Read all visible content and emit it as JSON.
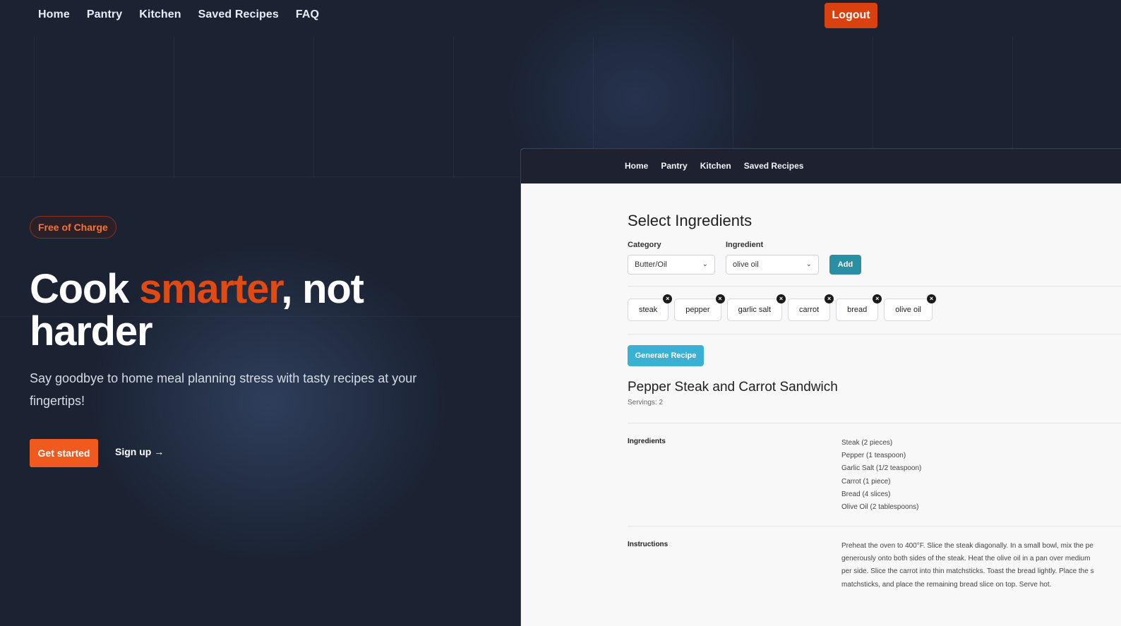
{
  "nav": {
    "links": [
      "Home",
      "Pantry",
      "Kitchen",
      "Saved Recipes",
      "FAQ"
    ],
    "logout_label": "Logout"
  },
  "hero": {
    "badge": "Free of Charge",
    "title_part1": "Cook ",
    "title_accent": "smarter",
    "title_part2": ", not harder",
    "subtitle": "Say goodbye to home meal planning stress with tasty recipes at your fingertips!",
    "cta_primary": "Get started",
    "cta_secondary": "Sign up →"
  },
  "app": {
    "nav_links": [
      "Home",
      "Pantry",
      "Kitchen",
      "Saved Recipes"
    ],
    "select_title": "Select Ingredients",
    "category_label": "Category",
    "category_value": "Butter/Oil",
    "ingredient_label": "Ingredient",
    "ingredient_value": "olive oil",
    "add_label": "Add",
    "chips": [
      "steak",
      "pepper",
      "garlic salt",
      "carrot",
      "bread",
      "olive oil"
    ],
    "remove_glyph": "×",
    "generate_label": "Generate Recipe",
    "recipe": {
      "title": "Pepper Steak and Carrot Sandwich",
      "servings": "Servings: 2",
      "ingredients_label": "Ingredients",
      "ingredients": [
        "Steak (2 pieces)",
        "Pepper (1 teaspoon)",
        "Garlic Salt (1/2 teaspoon)",
        "Carrot (1 piece)",
        "Bread (4 slices)",
        "Olive Oil (2 tablespoons)"
      ],
      "instructions_label": "Instructions",
      "instruction_lines": [
        "Preheat the oven to 400°F. Slice the steak diagonally. In a small bowl, mix the pe",
        "generously onto both sides of the steak. Heat the olive oil in a pan over medium",
        "per side. Slice the carrot into thin matchsticks. Toast the bread lightly. Place the s",
        "matchsticks, and place the remaining bread slice on top. Serve hot."
      ]
    }
  },
  "colors": {
    "accent": "#e04a13",
    "background": "#1b2333",
    "teal": "#2a8fa3",
    "generate": "#3ab0d2"
  }
}
